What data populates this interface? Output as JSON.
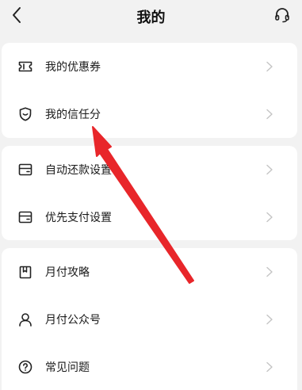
{
  "header": {
    "title": "我的",
    "back_icon": "chevron-left-icon",
    "support_icon": "headset-icon"
  },
  "groups": [
    {
      "items": [
        {
          "label": "我的优惠券",
          "icon": "coupon-icon"
        },
        {
          "label": "我的信任分",
          "icon": "shield-icon"
        }
      ]
    },
    {
      "items": [
        {
          "label": "自动还款设置",
          "icon": "wallet-icon"
        },
        {
          "label": "优先支付设置",
          "icon": "wallet-icon"
        }
      ]
    },
    {
      "items": [
        {
          "label": "月付攻略",
          "icon": "bookmark-book-icon"
        },
        {
          "label": "月付公众号",
          "icon": "person-icon"
        },
        {
          "label": "常见问题",
          "icon": "question-icon"
        }
      ]
    }
  ],
  "colors": {
    "background": "#f2f2f2",
    "card": "#ffffff",
    "chevron": "#c4c4c4",
    "annotation_arrow": "#e8262a"
  },
  "annotation": {
    "type": "arrow",
    "target": "我的信任分"
  }
}
